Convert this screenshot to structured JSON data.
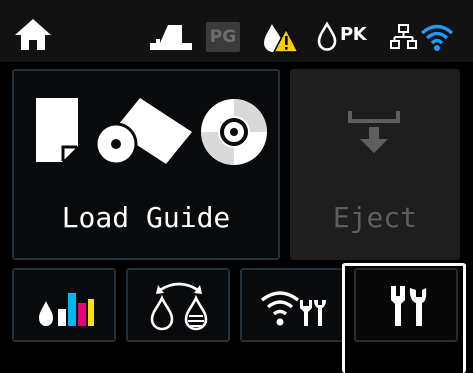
{
  "status_bar": {
    "home_icon": "home-icon",
    "printer_status_icon": "printer-status-icon",
    "pg_label": "PG",
    "ink_warning_icon": "ink-warning-icon",
    "pk_label": "PK",
    "network_icon": "wired-network-icon",
    "wifi_icon": "wifi-icon"
  },
  "tiles": {
    "load_guide": {
      "label": "Load Guide",
      "enabled": true
    },
    "eject": {
      "label": "Eject",
      "enabled": false
    }
  },
  "bottom_buttons": [
    {
      "name": "ink-levels",
      "icon": "ink-levels-icon"
    },
    {
      "name": "maintenance",
      "icon": "ink-drops-icon"
    },
    {
      "name": "network-settings",
      "icon": "wifi-tools-icon"
    },
    {
      "name": "settings",
      "icon": "tools-icon",
      "selected": true
    }
  ],
  "colors": {
    "background": "#000000",
    "tile_border": "#24313a",
    "wifi": "#1e9bff",
    "warning": "#f5d000",
    "ink_cyan": "#00b7f0",
    "ink_magenta": "#e6007e",
    "ink_yellow": "#ffe100",
    "disabled_text": "#5e5e5e"
  }
}
